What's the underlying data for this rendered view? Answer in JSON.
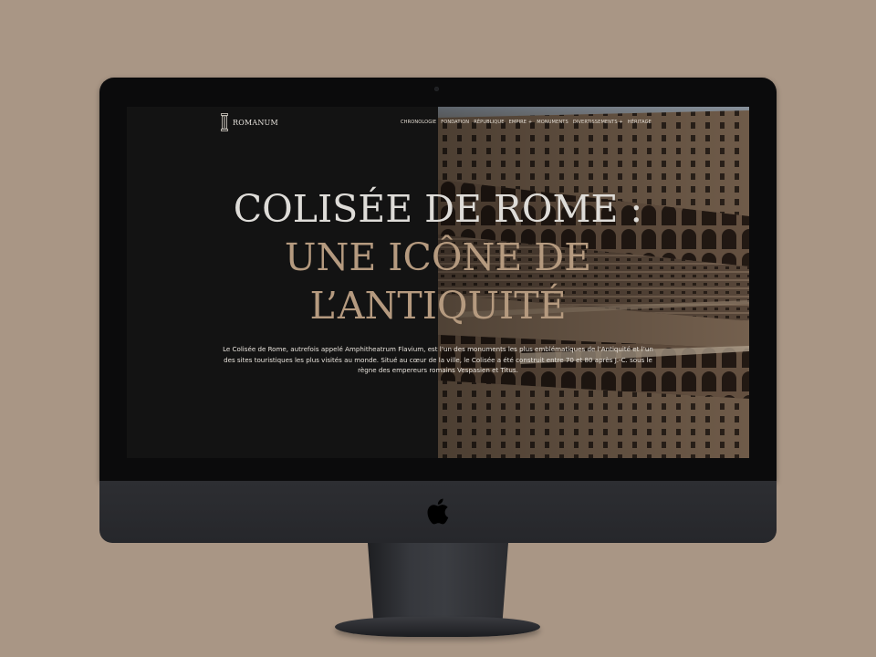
{
  "site": {
    "logo_text": "ROMANUM"
  },
  "nav": [
    {
      "label": "CHRONOLOGIE"
    },
    {
      "label": "FONDATION"
    },
    {
      "label": "RÉPUBLIQUE"
    },
    {
      "label": "EMPIRE +"
    },
    {
      "label": "MONUMENTS"
    },
    {
      "label": "DIVERTISSEMENTS +"
    },
    {
      "label": "HÉRITAGE"
    }
  ],
  "hero": {
    "title_line1": "COLISÉE DE ROME :",
    "title_line2": "UNE ICÔNE DE",
    "title_line3": "L’ANTIQUITÉ",
    "description": "Le Colisée de Rome, autrefois appelé Amphitheatrum Flavium, est l’un des monuments les plus emblématiques de l’Antiquité et l’un des sites touristiques les plus visités au monde. Situé au cœur de la ville, le Colisée a été construit entre 70 et 80 après J.-C. sous le règne des empereurs romains Vespasien et Titus."
  },
  "colors": {
    "background": "#a99685",
    "screen_bg": "#131313",
    "title_light": "#dedcd8",
    "title_accent": "#b59a7f"
  },
  "icons": {
    "logo": "column-logo-icon",
    "device_brand": "apple-logo-icon"
  }
}
